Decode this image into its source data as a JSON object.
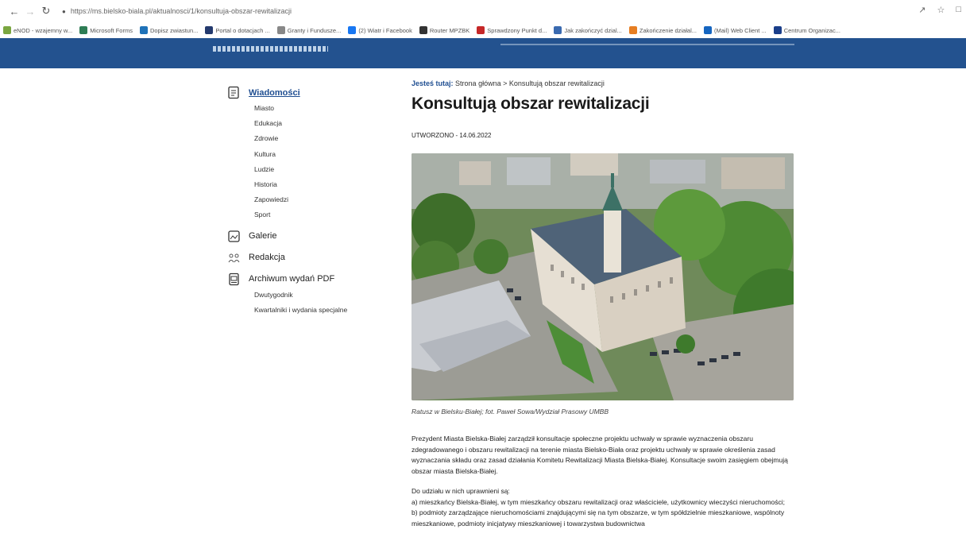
{
  "browser": {
    "url": "https://ms.bielsko-biala.pl/aktualnosci/1/konsultuja-obszar-rewitalizacji",
    "back_icon": "arrow-left-icon",
    "forward_icon": "arrow-right-icon",
    "reload_icon": "reload-icon",
    "bookmarks": [
      {
        "label": "eNOD - wzajemny w...",
        "color": "#7aa640"
      },
      {
        "label": "Microsoft Forms",
        "color": "#2e7d55"
      },
      {
        "label": "Dopisz zwiastun...",
        "color": "#1f72b8"
      },
      {
        "label": "Portal o dotacjach ...",
        "color": "#243a6e"
      },
      {
        "label": "Granty i Fundusze...",
        "color": "#888888"
      },
      {
        "label": "(2) Wiatr i Facebook",
        "color": "#1877f2"
      },
      {
        "label": "Router MPZBK",
        "color": "#333333"
      },
      {
        "label": "Sprawdzony Punkt d...",
        "color": "#c62828"
      },
      {
        "label": "Jak zakończyć dzial...",
        "color": "#3a6ab0"
      },
      {
        "label": "Zakończenie działal...",
        "color": "#e67e22"
      },
      {
        "label": "(Mail) Web Client ...",
        "color": "#1565c0"
      },
      {
        "label": "Centrum Organizac...",
        "color": "#1a3e8a"
      }
    ]
  },
  "colors": {
    "brand": "#23528f",
    "link": "#1f4e91"
  },
  "sidebar": {
    "sections": [
      {
        "label": "Wiadomości",
        "icon": "news-icon",
        "active": true,
        "items": [
          "Miasto",
          "Edukacja",
          "Zdrowie",
          "Kultura",
          "Ludzie",
          "Historia",
          "Zapowiedzi",
          "Sport"
        ]
      },
      {
        "label": "Galerie",
        "icon": "gallery-icon",
        "active": false,
        "items": []
      },
      {
        "label": "Redakcja",
        "icon": "team-icon",
        "active": false,
        "items": []
      },
      {
        "label": "Archiwum wydań PDF",
        "icon": "pdf-archive-icon",
        "active": false,
        "items": [
          "Dwutygodnik",
          "Kwartalniki i wydania specjalne"
        ]
      }
    ]
  },
  "article": {
    "breadcrumb_label": "Jesteś tutaj:",
    "breadcrumb_path": "Strona główna > Konsultują obszar rewitalizacji",
    "title": "Konsultują obszar rewitalizacji",
    "created": "UTWORZONO - 14.06.2022",
    "caption": "Ratusz w Bielsku-Białej; fot. Paweł Sowa/Wydział Prasowy UMBB",
    "paragraphs": [
      "Prezydent Miasta Bielska-Białej zarządził konsultacje społeczne projektu uchwały w sprawie wyznaczenia obszaru zdegradowanego i obszaru rewitalizacji na terenie miasta Bielsko-Biała oraz projektu uchwały w sprawie określenia zasad wyznaczania składu oraz zasad działania Komitetu Rewitalizacji Miasta Bielska-Białej. Konsultacje swoim zasięgiem obejmują obszar miasta Bielska-Białej.",
      "Do udziału w nich uprawnieni są:",
      "a) mieszkańcy Bielska-Białej, w tym mieszkańcy obszaru rewitalizacji oraz właściciele, użytkownicy wieczyści nieruchomości;",
      "b) podmioty zarządzające nieruchomościami znajdującymi się na tym obszarze, w tym spółdzielnie mieszkaniowe, wspólnoty mieszkaniowe, podmioty inicjatywy mieszkaniowej i towarzystwa budownictwa"
    ]
  }
}
